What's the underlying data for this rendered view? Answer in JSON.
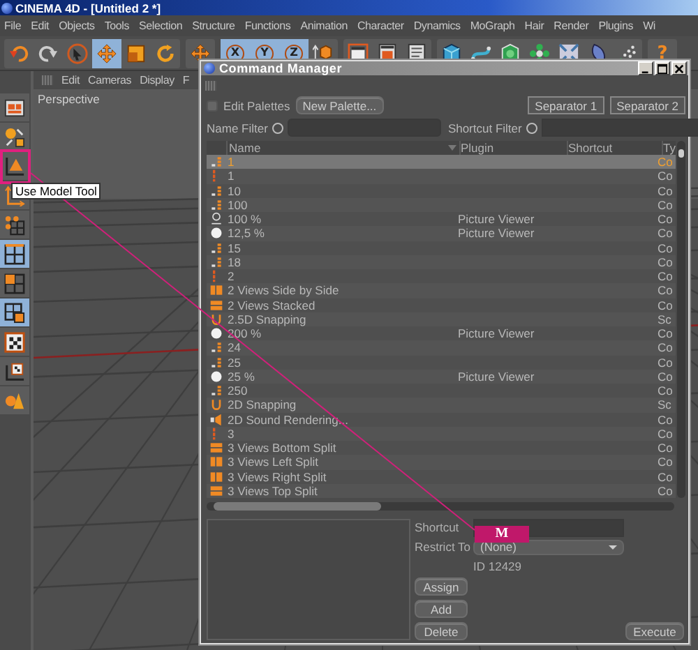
{
  "window": {
    "title": "CINEMA 4D - [Untitled 2 *]"
  },
  "menu": [
    "File",
    "Edit",
    "Objects",
    "Tools",
    "Selection",
    "Structure",
    "Functions",
    "Animation",
    "Character",
    "Dynamics",
    "MoGraph",
    "Hair",
    "Render",
    "Plugins",
    "Wi"
  ],
  "toolbar": [
    {
      "tools": [
        {
          "kind": "undo",
          "selected": false
        },
        {
          "kind": "redo",
          "selected": false
        },
        {
          "kind": "select",
          "selected": false
        },
        {
          "kind": "move",
          "selected": true
        },
        {
          "kind": "scale",
          "selected": false
        },
        {
          "kind": "rotate",
          "selected": false
        }
      ]
    },
    {
      "tools": [
        {
          "kind": "move",
          "selected": false
        }
      ]
    },
    {
      "tools": [
        {
          "kind": "axis",
          "label": "X",
          "selected": true
        },
        {
          "kind": "axis",
          "label": "Y",
          "selected": true
        },
        {
          "kind": "axis",
          "label": "Z",
          "selected": true
        },
        {
          "kind": "coords",
          "selected": false
        }
      ]
    },
    {
      "tools": [
        {
          "kind": "render",
          "selected": false
        },
        {
          "kind": "picture",
          "selected": false
        },
        {
          "kind": "settings",
          "selected": false
        }
      ]
    },
    {
      "tools": [
        {
          "kind": "cube",
          "selected": false
        },
        {
          "kind": "spline",
          "selected": false
        },
        {
          "kind": "nurbs",
          "selected": false
        },
        {
          "kind": "array",
          "selected": false
        },
        {
          "kind": "deformer",
          "selected": false
        },
        {
          "kind": "scene",
          "selected": false
        },
        {
          "kind": "particles",
          "selected": false
        }
      ]
    },
    {
      "tools": [
        {
          "kind": "help",
          "label": "?",
          "selected": false
        }
      ]
    }
  ],
  "left_tools": [
    {
      "kind": "region",
      "selected": false
    },
    {
      "kind": "modes",
      "selected": false
    },
    {
      "kind": "model",
      "selected": false
    },
    {
      "kind": "axis",
      "selected": false
    },
    {
      "kind": "points",
      "selected": false
    },
    {
      "kind": "edges",
      "selected": true
    },
    {
      "kind": "polygons",
      "selected": false
    },
    {
      "kind": "uv",
      "selected": true
    },
    {
      "kind": "texture",
      "selected": false
    },
    {
      "kind": "texaxis",
      "selected": false
    },
    {
      "kind": "workplane",
      "selected": false
    }
  ],
  "viewport": {
    "menu": [
      "Edit",
      "Cameras",
      "Display",
      "F"
    ],
    "label": "Perspective"
  },
  "command_manager": {
    "title": "Command Manager",
    "edit_palettes": {
      "label": "Edit Palettes",
      "checked": false
    },
    "buttons": [
      "New Palette...",
      "Separator 1",
      "Separator 2"
    ],
    "name_filter": {
      "label": "Name Filter"
    },
    "shortcut_filter": {
      "label": "Shortcut Filter"
    },
    "columns": [
      "Name",
      "Plugin",
      "Shortcut",
      "Ty"
    ],
    "rows": [
      {
        "kind": "bars",
        "name": "1",
        "plugin": "",
        "shortcut": "",
        "ty": "Co",
        "selected": true
      },
      {
        "kind": "bar",
        "name": "1",
        "plugin": "",
        "shortcut": "",
        "ty": "Co",
        "selected": false
      },
      {
        "kind": "bars",
        "name": "10",
        "plugin": "",
        "shortcut": "",
        "ty": "Co",
        "selected": false
      },
      {
        "kind": "bars",
        "name": "100",
        "plugin": "",
        "shortcut": "",
        "ty": "Co",
        "selected": false
      },
      {
        "kind": "zoom",
        "name": "100 %",
        "plugin": "Picture Viewer",
        "shortcut": "",
        "ty": "Co",
        "selected": false
      },
      {
        "kind": "dot",
        "name": "12,5 %",
        "plugin": "Picture Viewer",
        "shortcut": "",
        "ty": "Co",
        "selected": false
      },
      {
        "kind": "bars",
        "name": "15",
        "plugin": "",
        "shortcut": "",
        "ty": "Co",
        "selected": false
      },
      {
        "kind": "bars",
        "name": "18",
        "plugin": "",
        "shortcut": "",
        "ty": "Co",
        "selected": false
      },
      {
        "kind": "bar",
        "name": "2",
        "plugin": "",
        "shortcut": "",
        "ty": "Co",
        "selected": false
      },
      {
        "kind": "split-v",
        "name": "2 Views Side by Side",
        "plugin": "",
        "shortcut": "",
        "ty": "Co",
        "selected": false
      },
      {
        "kind": "split-h",
        "name": "2 Views Stacked",
        "plugin": "",
        "shortcut": "",
        "ty": "Co",
        "selected": false
      },
      {
        "kind": "snap",
        "name": "2.5D Snapping",
        "plugin": "",
        "shortcut": "",
        "ty": "Sc",
        "selected": false
      },
      {
        "kind": "dot",
        "name": "200 %",
        "plugin": "Picture Viewer",
        "shortcut": "",
        "ty": "Co",
        "selected": false
      },
      {
        "kind": "bars",
        "name": "24",
        "plugin": "",
        "shortcut": "",
        "ty": "Co",
        "selected": false
      },
      {
        "kind": "bars",
        "name": "25",
        "plugin": "",
        "shortcut": "",
        "ty": "Co",
        "selected": false
      },
      {
        "kind": "dot",
        "name": "25 %",
        "plugin": "Picture Viewer",
        "shortcut": "",
        "ty": "Co",
        "selected": false
      },
      {
        "kind": "bars",
        "name": "250",
        "plugin": "",
        "shortcut": "",
        "ty": "Co",
        "selected": false
      },
      {
        "kind": "snap",
        "name": "2D Snapping",
        "plugin": "",
        "shortcut": "",
        "ty": "Sc",
        "selected": false
      },
      {
        "kind": "sound",
        "name": "2D Sound Rendering...",
        "plugin": "",
        "shortcut": "",
        "ty": "Co",
        "selected": false
      },
      {
        "kind": "bar",
        "name": "3",
        "plugin": "",
        "shortcut": "",
        "ty": "Co",
        "selected": false
      },
      {
        "kind": "split-h",
        "name": "3 Views Bottom Split",
        "plugin": "",
        "shortcut": "",
        "ty": "Co",
        "selected": false
      },
      {
        "kind": "split-v",
        "name": "3 Views Left Split",
        "plugin": "",
        "shortcut": "",
        "ty": "Co",
        "selected": false
      },
      {
        "kind": "split-v",
        "name": "3 Views Right Split",
        "plugin": "",
        "shortcut": "",
        "ty": "Co",
        "selected": false
      },
      {
        "kind": "split-h",
        "name": "3 Views Top Split",
        "plugin": "",
        "shortcut": "",
        "ty": "Co",
        "selected": false
      }
    ],
    "shortcut_label": "Shortcut",
    "restrict_label": "Restrict To",
    "restrict_value": "(None)",
    "id_text": "ID 12429",
    "actions": [
      "Assign",
      "Add",
      "Delete"
    ],
    "execute": "Execute"
  },
  "annotation": {
    "tooltip": "Use Model Tool",
    "label": "M"
  }
}
